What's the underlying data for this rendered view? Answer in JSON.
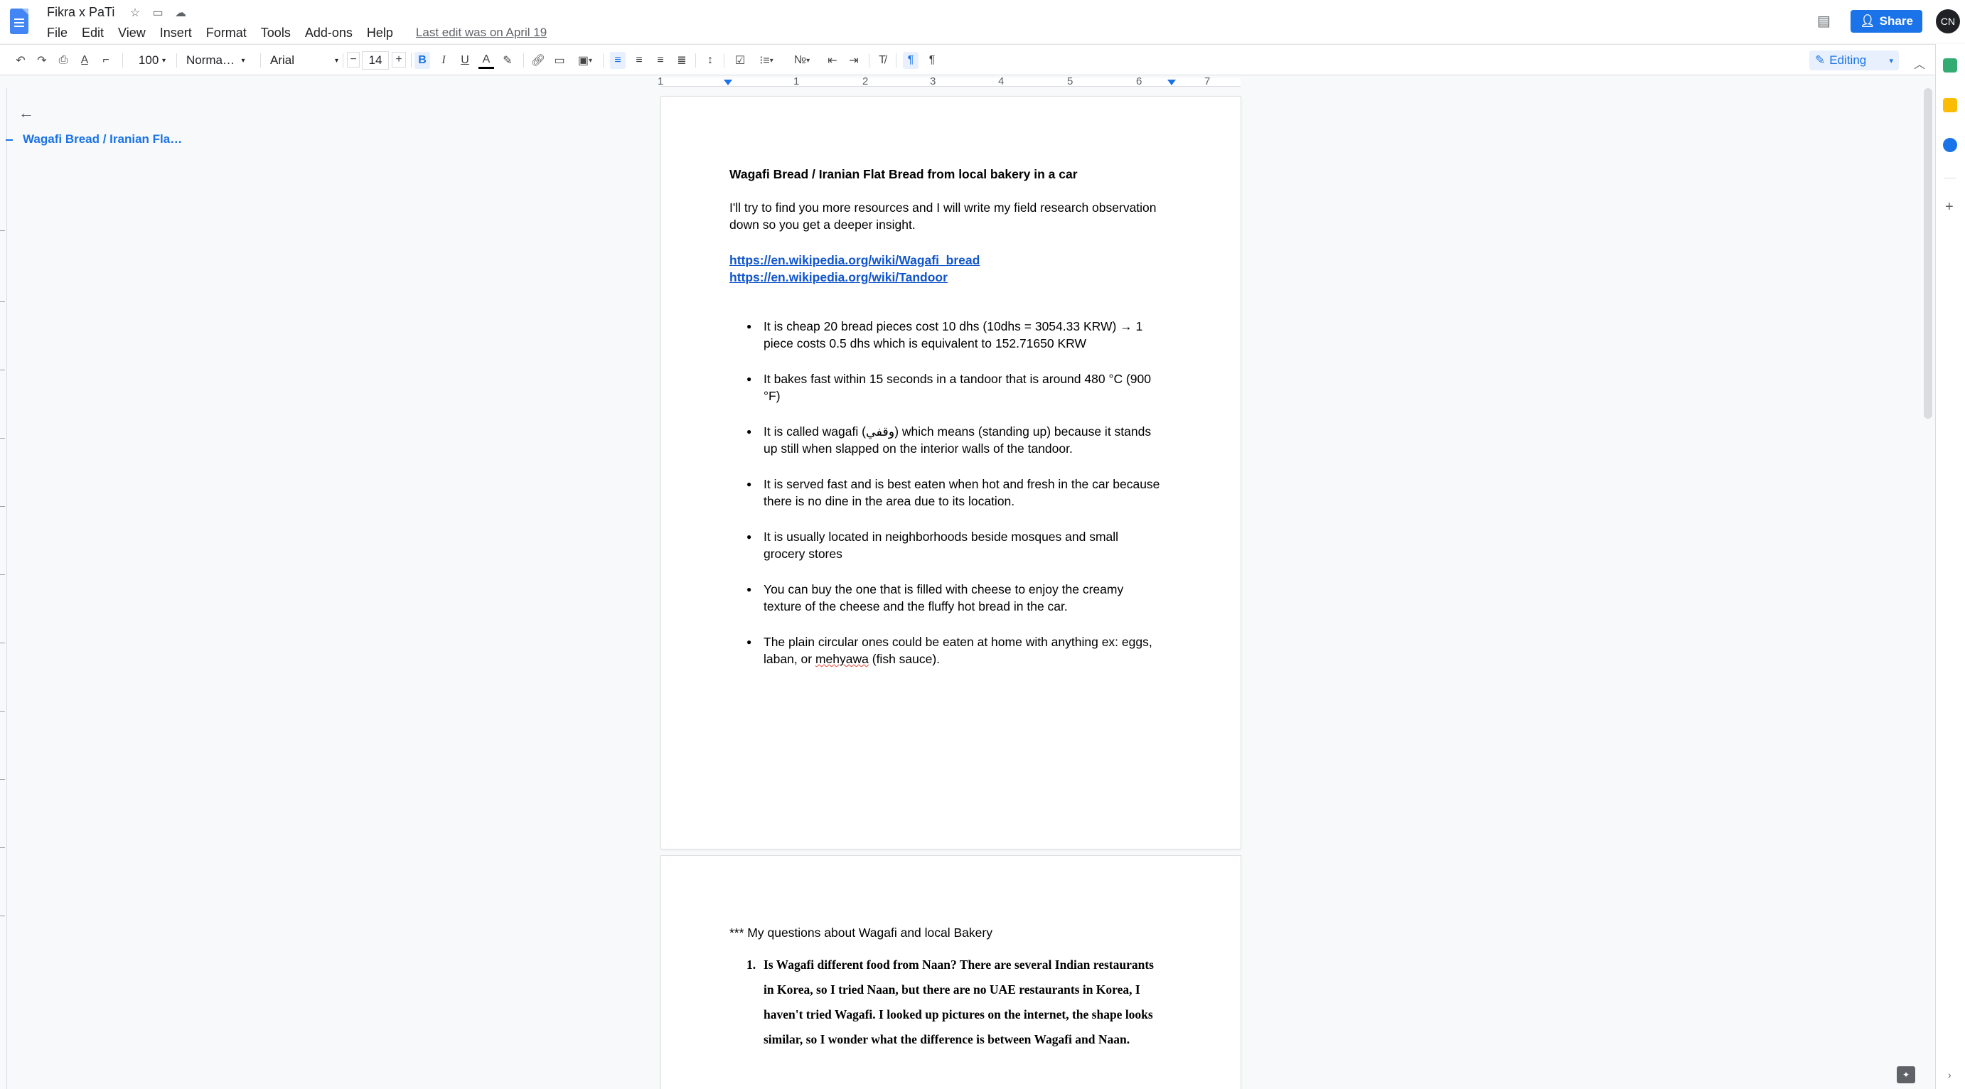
{
  "header": {
    "title": "Fikra x PaTi",
    "menu": [
      "File",
      "Edit",
      "View",
      "Insert",
      "Format",
      "Tools",
      "Add-ons",
      "Help"
    ],
    "last_edit": "Last edit was on April 19",
    "share_label": "Share",
    "avatar_initials": "CN"
  },
  "toolbar": {
    "zoom": "100",
    "style": "Norma…",
    "font": "Arial",
    "font_size": "14",
    "mode": "Editing",
    "icons": [
      "undo-icon",
      "redo-icon",
      "print-icon",
      "spellcheck-icon",
      "paint-format-icon",
      "bold-icon",
      "italic-icon",
      "underline-icon",
      "text-color-icon",
      "highlight-icon",
      "link-icon",
      "comment-icon",
      "image-icon",
      "align-left-icon",
      "align-center-icon",
      "align-right-icon",
      "justify-icon",
      "line-spacing-icon",
      "checklist-icon",
      "bulleted-list-icon",
      "numbered-list-icon",
      "decrease-indent-icon",
      "increase-indent-icon",
      "clear-formatting-icon",
      "ltr-icon",
      "rtl-icon"
    ]
  },
  "ruler": {
    "numbers": [
      "1",
      "1",
      "2",
      "3",
      "4",
      "5",
      "6",
      "7"
    ]
  },
  "outline": {
    "item": "Wagafi Bread / Iranian Fla…"
  },
  "page1": {
    "heading": "Wagafi Bread / Iranian Flat Bread from local bakery in a car",
    "intro_line1": "I'll try to find you more resources and I will write my field research observation",
    "intro_line2": "down so you get a deeper insight.",
    "link1": "https://en.wikipedia.org/wiki/Wagafi_bread",
    "link2": "https://en.wikipedia.org/wiki/Tandoor",
    "bullets": [
      {
        "l1": "It is cheap 20 bread pieces cost 10 dhs (10dhs = 3054.33 KRW) → 1",
        "l2": "piece costs 0.5 dhs which is equivalent to 152.71650 KRW"
      },
      {
        "l1": "It bakes fast within 15 seconds in a tandoor that is around 480 °C (900",
        "l2": "°F)"
      },
      {
        "l1": "It is called wagafi (وقفي) which means (standing up) because it stands",
        "l2": "up still when slapped on the interior walls of the tandoor."
      },
      {
        "l1": "It is served fast and is best eaten when hot and fresh in the car because",
        "l2": "there is no dine in the area due to its location."
      },
      {
        "l1": "It is usually located in neighborhoods beside mosques and small",
        "l2": "grocery stores"
      },
      {
        "l1": "You can buy the one that is filled with cheese to enjoy the creamy",
        "l2": "texture of the cheese and the fluffy hot bread in the car."
      },
      {
        "l1": "The plain circular ones could be eaten at home with anything ex: eggs,",
        "l2a": "laban, or ",
        "l2b": "mehyawa",
        "l2c": " (fish sauce)."
      }
    ]
  },
  "page2": {
    "heading": "*** My questions about Wagafi and local Bakery",
    "q1_num": "1.",
    "q1_lines": [
      "Is Wagafi different food from Naan? There are several Indian restaurants",
      "in Korea, so I tried Naan, but there are no UAE restaurants in Korea, I",
      "haven't tried Wagafi. I looked up pictures on the internet, the shape looks",
      "similar, so I wonder what the difference is between Wagafi and Naan."
    ]
  },
  "colors": {
    "accent": "#1a73e8",
    "link": "#1155cc",
    "spell_error": "#ea4335"
  }
}
